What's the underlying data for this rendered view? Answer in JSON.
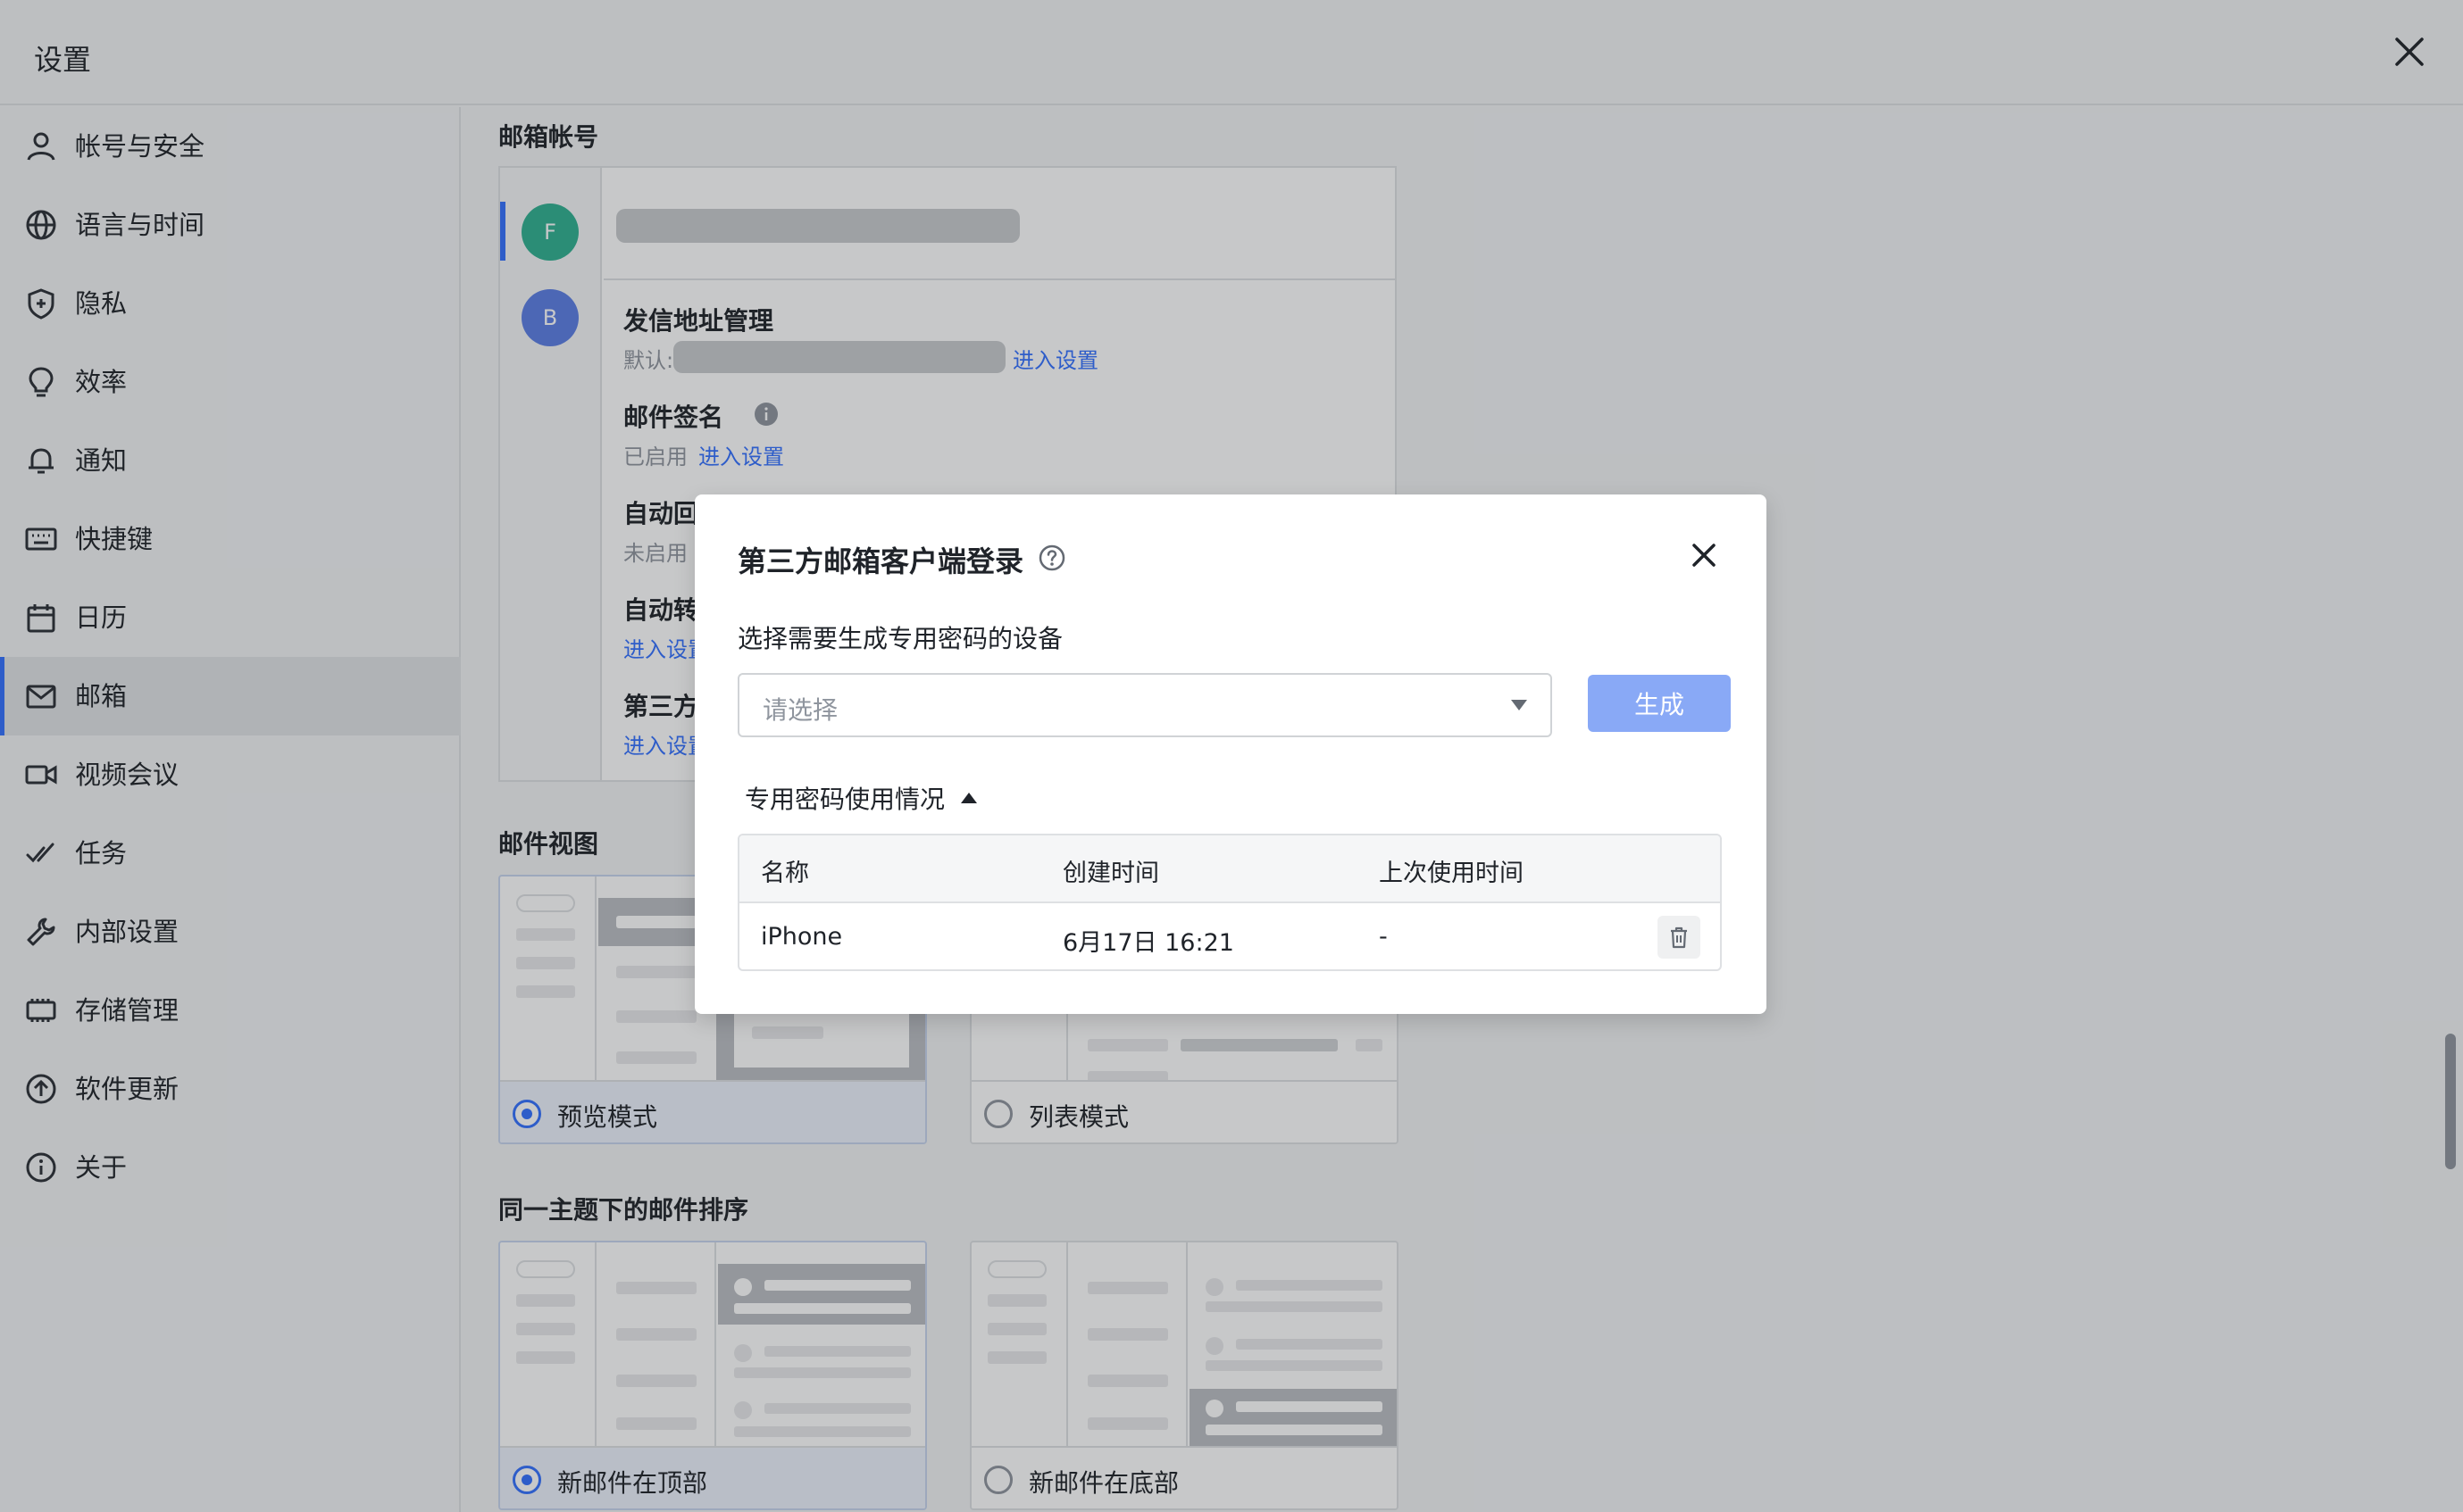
{
  "window": {
    "title": "设置",
    "close_icon": "close-icon"
  },
  "sidebar": {
    "items": [
      {
        "label": "帐号与安全",
        "icon": "user-icon"
      },
      {
        "label": "语言与时间",
        "icon": "globe-icon"
      },
      {
        "label": "隐私",
        "icon": "shield-icon"
      },
      {
        "label": "效率",
        "icon": "bulb-icon"
      },
      {
        "label": "通知",
        "icon": "bell-icon"
      },
      {
        "label": "快捷键",
        "icon": "keyboard-icon"
      },
      {
        "label": "日历",
        "icon": "calendar-icon"
      },
      {
        "label": "邮箱",
        "icon": "mail-icon",
        "active": true
      },
      {
        "label": "视频会议",
        "icon": "video-icon"
      },
      {
        "label": "任务",
        "icon": "task-icon"
      },
      {
        "label": "内部设置",
        "icon": "wrench-icon"
      },
      {
        "label": "存储管理",
        "icon": "storage-icon"
      },
      {
        "label": "软件更新",
        "icon": "update-icon"
      },
      {
        "label": "关于",
        "icon": "info-icon"
      }
    ]
  },
  "mail_account": {
    "section_title": "邮箱帐号",
    "accounts": [
      {
        "initial": "F",
        "color": "#2fb090",
        "selected": true
      },
      {
        "initial": "B",
        "color": "#5b7ee5",
        "selected": false
      }
    ],
    "settings": [
      {
        "title": "发信地址管理",
        "sub": "默认:",
        "link": "进入设置"
      },
      {
        "title": "邮件签名",
        "sub": "已启用",
        "link": "进入设置"
      },
      {
        "title": "自动回",
        "sub": "未启用",
        "link": ""
      },
      {
        "title": "自动转",
        "sub": "",
        "link": "进入设置"
      },
      {
        "title": "第三方",
        "sub": "",
        "link": "进入设置"
      }
    ]
  },
  "mail_view": {
    "section_title": "邮件视图",
    "options": [
      {
        "label": "预览模式",
        "selected": true
      },
      {
        "label": "列表模式",
        "selected": false
      }
    ]
  },
  "thread_order": {
    "section_title": "同一主题下的邮件排序",
    "options": [
      {
        "label": "新邮件在顶部",
        "selected": true
      },
      {
        "label": "新邮件在底部",
        "selected": false
      }
    ]
  },
  "dialog": {
    "title": "第三方邮箱客户端登录",
    "help_icon": "help-icon",
    "device_label": "选择需要生成专用密码的设备",
    "select_placeholder": "请选择",
    "generate_button": "生成",
    "usage_toggle": "专用密码使用情况",
    "table": {
      "headers": [
        "名称",
        "创建时间",
        "上次使用时间"
      ],
      "rows": [
        {
          "name": "iPhone",
          "created": "6月17日 16:21",
          "last_used": "-"
        }
      ]
    }
  },
  "colors": {
    "accent": "#3370ff",
    "button_disabled": "#89a9f6",
    "avatar_f": "#2fb090",
    "avatar_b": "#5b7ee5"
  }
}
